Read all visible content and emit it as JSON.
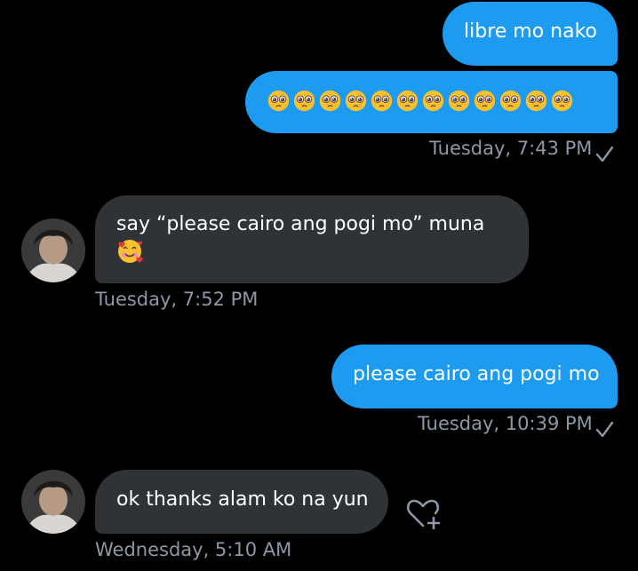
{
  "conversation": {
    "messages": [
      {
        "type": "sent",
        "text": "libre mo nako"
      },
      {
        "type": "sent",
        "emoji_name": "pleading-face",
        "emoji_count": 12,
        "timestamp": "Tuesday, 7:43 PM",
        "read_icon": "checkmark-icon"
      },
      {
        "type": "received",
        "text": "say “please cairo ang pogi mo” muna",
        "emoji_name": "smiling-face-with-hearts",
        "timestamp": "Tuesday, 7:52 PM"
      },
      {
        "type": "sent",
        "text": "please cairo ang pogi mo",
        "timestamp": "Tuesday, 10:39 PM",
        "read_icon": "checkmark-icon"
      },
      {
        "type": "received",
        "text": "ok thanks alam ko na yun",
        "timestamp": "Wednesday, 5:10 AM",
        "reaction_icon": "heart-plus-icon"
      }
    ]
  },
  "colors": {
    "background": "#000000",
    "sent_bubble": "#1d9bf0",
    "received_bubble": "#2f3336",
    "timestamp": "#8b98a5",
    "text": "#ffffff"
  }
}
